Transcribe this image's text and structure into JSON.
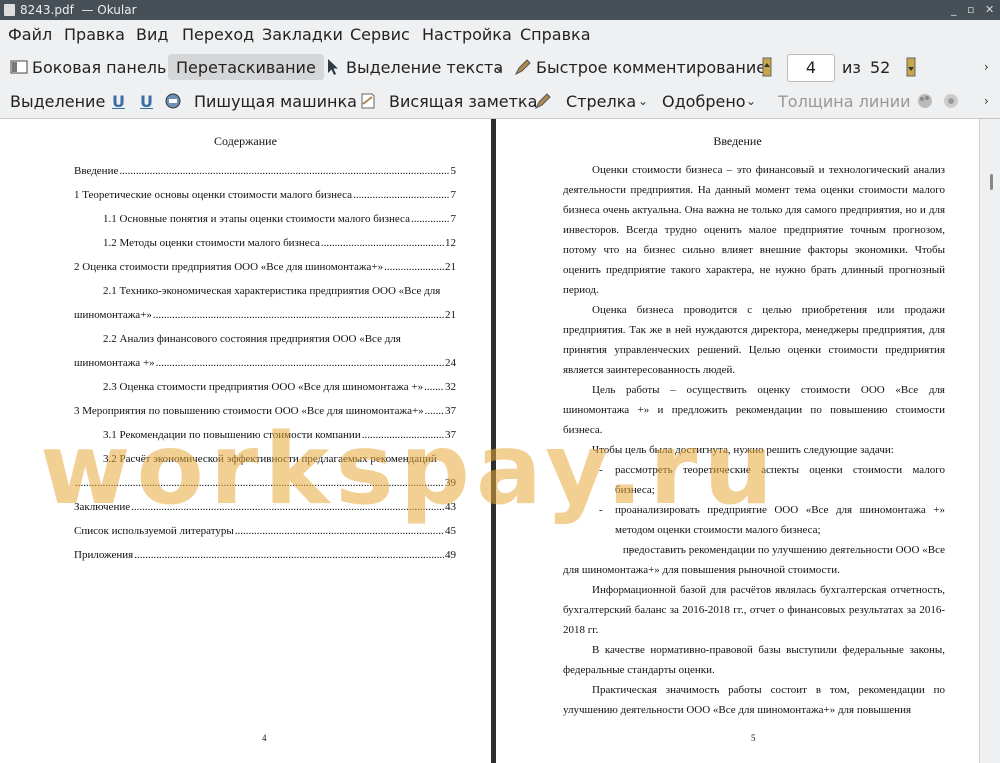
{
  "titlebar": {
    "title": "8243.pdf  — Okular",
    "min": "_",
    "max": "▫",
    "close": "✕"
  },
  "menu": [
    "Файл",
    "Правка",
    "Вид",
    "Переход",
    "Закладки",
    "Сервис",
    "Настройка",
    "Справка"
  ],
  "toolbar1": {
    "sidebar": "Боковая панель",
    "drag": "Перетаскивание",
    "text_select": "Выделение текста",
    "quick_comment": "Быстрое комментирование",
    "page_current": "4",
    "page_of": "из",
    "page_total": "52"
  },
  "toolbar2": {
    "selection": "Выделение",
    "typewriter": "Пишущая машинка",
    "note": "Висящая заметка",
    "arrow": "Стрелка",
    "approved": "Одобрено",
    "line_width": "Толщина линии"
  },
  "page1": {
    "title": "Содержание",
    "toc": [
      {
        "text": "Введение",
        "page": "5"
      },
      {
        "text": "1 Теоретические основы оценки стоимости малого бизнеса",
        "page": "7"
      },
      {
        "text": "1.1 Основные понятия и этапы оценки стоимости малого бизнеса",
        "page": "7"
      },
      {
        "text": "1.2 Методы оценки стоимости малого бизнеса",
        "page": "12"
      },
      {
        "text": "2 Оценка стоимости предприятия ООО «Все для шиномонтажа+»",
        "page": "21"
      },
      {
        "text": "2.1 Технико-экономическая характеристика предприятия ООО «Все для",
        "text2": "шиномонтажа+»",
        "page": "21"
      },
      {
        "text": "2.2 Анализ финансового состояния предприятия ООО «Все для",
        "text2": "шиномонтажа +»",
        "page": "24"
      },
      {
        "text": "2.3 Оценка стоимости предприятия ООО «Все для шиномонтажа +»",
        "page": "32"
      },
      {
        "text": "3 Мероприятия по повышению стоимости ООО «Все для шиномонтажа+»",
        "page": "37"
      },
      {
        "text": "3.1 Рекомендации по повышению стоимости компании",
        "page": "37"
      },
      {
        "text": "3.2 Расчёт экономической эффективности предлагаемых рекомендаций",
        "text2": "",
        "page": "39"
      },
      {
        "text": "Заключение",
        "page": "43"
      },
      {
        "text": "Список используемой литературы",
        "page": "45"
      },
      {
        "text": "Приложения",
        "page": "49"
      }
    ],
    "page_number": "4"
  },
  "page2": {
    "title": "Введение",
    "p1": "Оценки стоимости бизнеса – это финансовый и технологический анализ деятельности предприятия. На данный момент тема оценки стоимости малого бизнеса очень актуальна. Она важна не только для самого предприятия, но и для инвесторов. Всегда трудно оценить малое предприятие точным прогнозом, потому что на бизнес сильно влияет внешние факторы экономики. Чтобы оценить предприятие такого характера, не нужно брать длинный прогнозный период.",
    "p2": "Оценка бизнеса проводится с целью приобретения или продажи предприятия. Так же в ней нуждаются директора, менеджеры предприятия, для принятия управленческих решений. Целью оценки стоимости предприятия является заинтересованность людей.",
    "p3": "Цель работы – осуществить оценку стоимости ООО «Все для шиномонтажа +» и предложить рекомендации по повышению стоимости бизнеса.",
    "p4": "Чтобы цель была достигнута, нужно решить следующие задачи:",
    "li1": "рассмотреть теоретические аспекты оценки стоимости малого бизнеса;",
    "li2": "проанализировать предприятие ООО «Все для шиномонтажа +» методом оценки стоимости малого бизнеса;",
    "li3": " предоставить рекомендации по улучшению деятельности ООО «Все для шиномонтажа+» для повышения рыночной стоимости.",
    "p5": "Информационной базой для расчётов являлась бухгалтерская отчетность, бухгалтерский баланс за 2016-2018 гг., отчет о финансовых результатах за 2016-2018 гг.",
    "p6": "В качестве нормативно-правовой базы выступили федеральные законы, федеральные стандарты оценки.",
    "p7": "Практическая значимость работы состоит в том, рекомендации по улучшению деятельности ООО «Все для шиномонтажа+» для повышения",
    "dash": "-",
    "page_number": "5"
  },
  "watermark": "workspay.ru"
}
